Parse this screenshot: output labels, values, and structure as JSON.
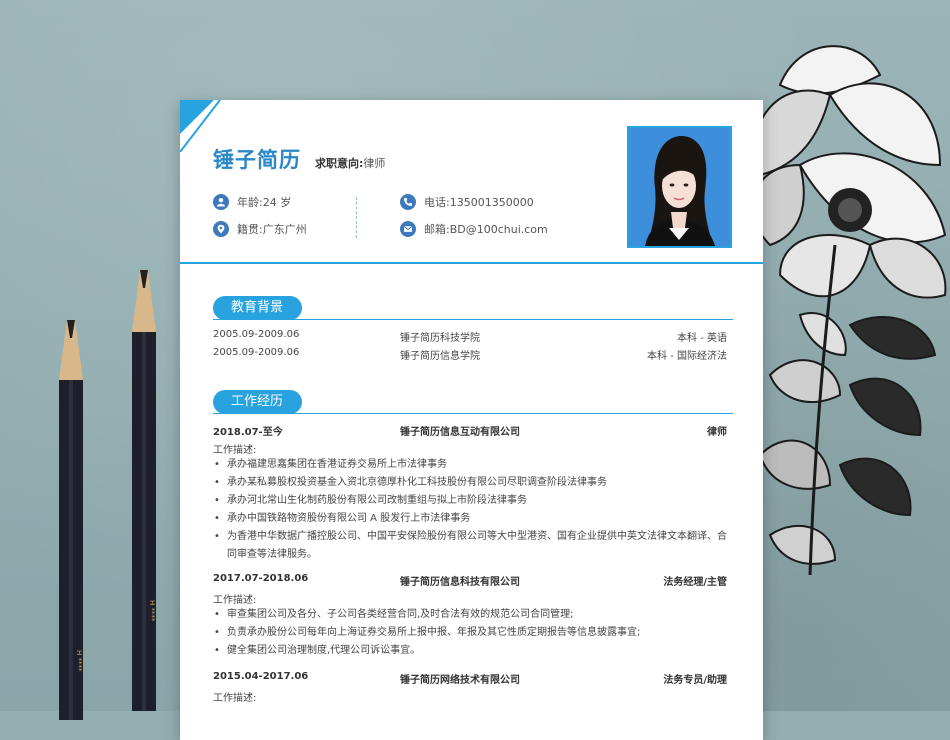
{
  "resume": {
    "name": "锤子简历",
    "intent_label": "求职意向:",
    "intent_value": "律师",
    "info": {
      "age": "年龄:24 岁",
      "origin": "籍贯:广东广州",
      "phone": "电话:135001350000",
      "email": "邮箱:BD@100chui.com"
    }
  },
  "education": {
    "title": "教育背景",
    "rows": [
      {
        "date": "2005.09-2009.06",
        "school": "锤子简历科技学院",
        "degree": "本科 - 英语"
      },
      {
        "date": "2005.09-2009.06",
        "school": "锤子简历信息学院",
        "degree": "本科 - 国际经济法"
      }
    ]
  },
  "work": {
    "title": "工作经历",
    "jobs": [
      {
        "date": "2018.07-至今",
        "company": "锤子简历信息互动有限公司",
        "role": "律师",
        "desc_label": "工作描述:",
        "items": [
          "承办福建思嘉集团在香港证券交易所上市法律事务",
          "承办某私募股权投资基金入资北京德厚朴化工科技股份有限公司尽职调查阶段法律事务",
          "承办河北常山生化制药股份有限公司改制重组与拟上市阶段法律事务",
          "承办中国铁路物资股份有限公司 A 股发行上市法律事务",
          "为香港中华数据广播控股公司、中国平安保险股份有限公司等大中型港资、国有企业提供中英文法律文本翻译、合同审查等法律服务。"
        ]
      },
      {
        "date": "2017.07-2018.06",
        "company": "锤子简历信息科技有限公司",
        "role": "法务经理/主管",
        "desc_label": "工作描述:",
        "items": [
          "审查集团公司及各分、子公司各类经营合同,及时合法有效的规范公司合同管理;",
          "负责承办股份公司每年向上海证券交易所上报中报、年报及其它性质定期报告等信息披露事宜;",
          "健全集团公司治理制度,代理公司诉讼事宜。"
        ]
      },
      {
        "date": "2015.04-2017.06",
        "company": "锤子简历网络技术有限公司",
        "role": "法务专员/助理",
        "desc_label": "工作描述:",
        "items": []
      }
    ]
  },
  "colors": {
    "accent": "#29a3df",
    "name": "#2a87c8",
    "icon": "#3f79bd"
  }
}
